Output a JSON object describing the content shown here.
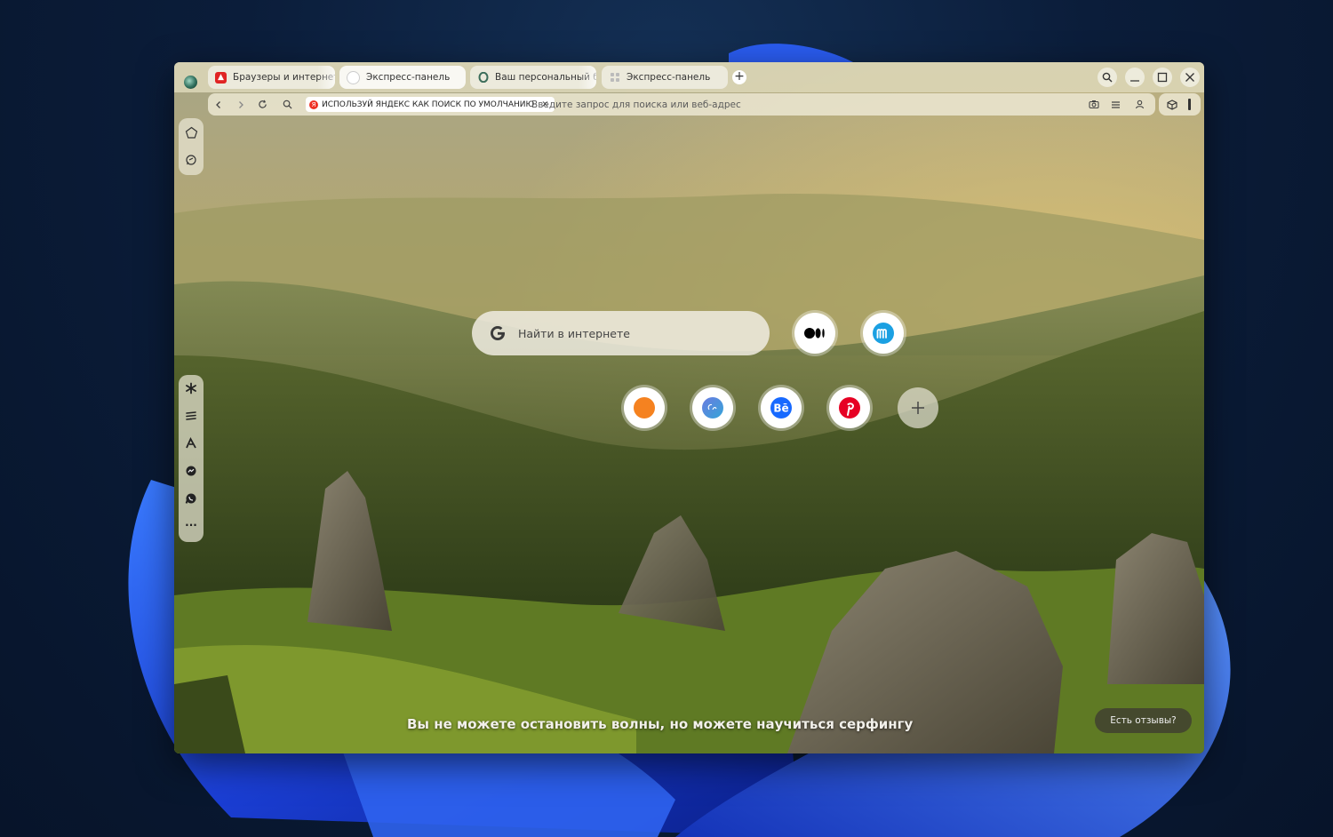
{
  "tabs": [
    {
      "title": "Браузеры и интернет. C",
      "favicon": "red-square-favicon",
      "color": "#e02424",
      "active": false
    },
    {
      "title": "Экспресс-панель",
      "favicon": "speed-dial-favicon",
      "color": "#ffffff",
      "active": true
    },
    {
      "title": "Ваш персональный бра",
      "favicon": "opera-favicon",
      "color": "#3b6d5a",
      "active": false
    },
    {
      "title": "Экспресс-панель",
      "favicon": "speed-dial-favicon",
      "color": "#ffffff",
      "active": false
    }
  ],
  "toolbar": {
    "new_tab_label": "+",
    "promo_text": "ИСПОЛЬЗУЙ ЯНДЕКС КАК ПОИСК ПО УМОЛЧАНИЮ",
    "promo_close": "×",
    "address_placeholder": "Введите запрос для поиска или веб-адрес"
  },
  "speed_dial": {
    "search_placeholder": "Найти в интернете",
    "top_row": [
      {
        "name": "medium-icon",
        "accent": "#000000"
      },
      {
        "name": "m-logo-icon",
        "accent": "#1ba0e2"
      }
    ],
    "bottom_row": [
      {
        "name": "orange-circle-icon",
        "accent": "#f58220"
      },
      {
        "name": "canva-icon",
        "accent": "#4c7bd9"
      },
      {
        "name": "behance-icon",
        "accent": "#1769ff",
        "label": "Bē"
      },
      {
        "name": "pinterest-icon",
        "accent": "#e60023"
      },
      {
        "name": "add-site-icon",
        "accent": "#ffffff"
      }
    ]
  },
  "quote": "Вы не можете остановить волны, но можете научиться серфингу",
  "feedback_button": "Есть отзывы?",
  "colors": {
    "desktop_bg": "#0b1d3a",
    "bloom": "#1f4fd8"
  }
}
